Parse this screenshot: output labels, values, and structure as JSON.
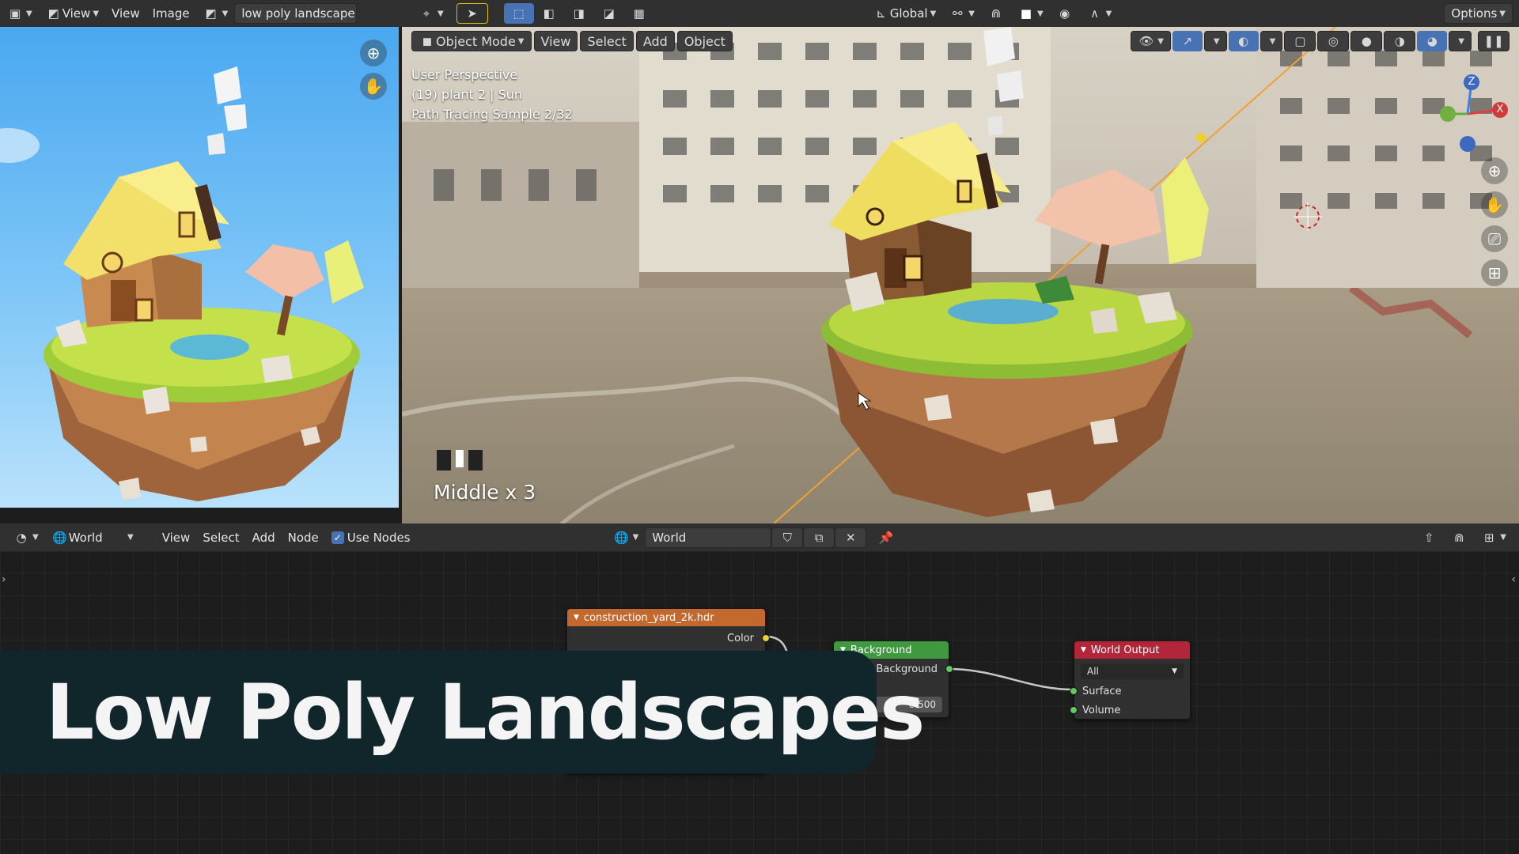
{
  "left_header": {
    "view_menu": "View",
    "view_menu2": "View",
    "image_menu": "Image",
    "image_name": "low poly landscape c"
  },
  "top_header": {
    "orientation": "Global",
    "options": "Options"
  },
  "viewport_header": {
    "mode": "Object Mode",
    "menus": [
      "View",
      "Select",
      "Add",
      "Object"
    ]
  },
  "viewport_overlay": {
    "line1": "User Perspective",
    "line2": "(19) plant 2 | Sun",
    "line3": "Path Tracing Sample 2/32",
    "key_hint": "Middle x 3"
  },
  "gizmo": {
    "z": "Z",
    "x": "X"
  },
  "node_header": {
    "world_type": "World",
    "menus": [
      "View",
      "Select",
      "Add",
      "Node"
    ],
    "use_nodes": "Use Nodes",
    "world_name": "World"
  },
  "nodes": {
    "env_texture": {
      "title": "construction_yard_2k.hdr",
      "output": "Color"
    },
    "background": {
      "title": "Background",
      "output": "Background",
      "strength_label": "gth",
      "strength_value": "0.500"
    },
    "world_output": {
      "title": "World Output",
      "target": "All",
      "surface": "Surface",
      "volume": "Volume"
    }
  },
  "banner": {
    "title": "Low Poly Landscapes"
  },
  "colors": {
    "env_header": "#c3692d",
    "bg_header": "#3f9a3f",
    "out_header": "#b3263a",
    "accent": "#4772b3",
    "banner": "#11262b"
  }
}
